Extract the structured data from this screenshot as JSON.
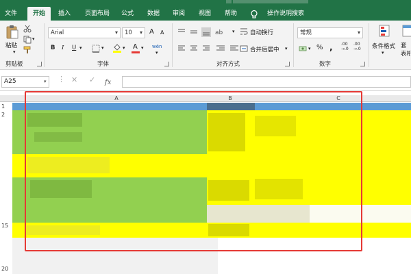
{
  "ribbon_tabs": [
    {
      "label": "文件",
      "active": false
    },
    {
      "label": "开始",
      "active": true
    },
    {
      "label": "插入",
      "active": false
    },
    {
      "label": "页面布局",
      "active": false
    },
    {
      "label": "公式",
      "active": false
    },
    {
      "label": "数据",
      "active": false
    },
    {
      "label": "审阅",
      "active": false
    },
    {
      "label": "视图",
      "active": false
    },
    {
      "label": "帮助",
      "active": false
    },
    {
      "label": "操作说明搜索",
      "active": false
    }
  ],
  "clipboard": {
    "paste_label": "粘贴",
    "group_label": "剪贴板"
  },
  "font": {
    "name": "Arial",
    "size": "10",
    "bold": "B",
    "italic": "I",
    "underline": "U",
    "grow": "A",
    "shrink": "A",
    "color_letter": "A",
    "phonetic": "wén",
    "group_label": "字体"
  },
  "alignment": {
    "wrap_label": "自动换行",
    "merge_label": "合并后居中",
    "group_label": "对齐方式"
  },
  "number": {
    "format": "常规",
    "percent": "%",
    "comma": ",",
    "dec_more": ".00\n→.0",
    "dec_less": ".00\n→.0",
    "group_label": "数字"
  },
  "styles": {
    "conditional_label": "条件格式",
    "table_label": "套\n表格"
  },
  "formula_bar": {
    "name_box": "A25"
  },
  "columns": [
    "A",
    "B",
    "C"
  ],
  "row_labels": [
    "1",
    "2",
    "15",
    "20"
  ],
  "colors": {
    "ribbon_green": "#217346",
    "cell_green": "#92d050",
    "cell_yellow": "#ffff00",
    "header_blue": "#5b9bd5",
    "highlight": "#e53935"
  }
}
